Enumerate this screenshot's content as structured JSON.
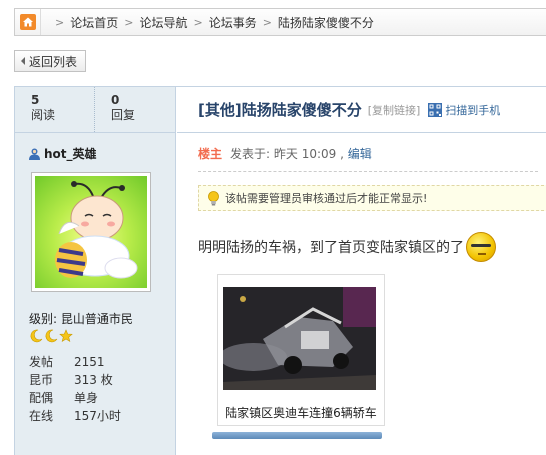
{
  "breadcrumb": {
    "items": [
      "论坛首页",
      "论坛导航",
      "论坛事务",
      "陆扬陆家傻傻不分"
    ]
  },
  "back_button": {
    "label": "返回列表"
  },
  "thread_stats": {
    "reads": {
      "value": "5",
      "label": "阅读"
    },
    "replies": {
      "value": "0",
      "label": "回复"
    }
  },
  "thread": {
    "title": "[其他]陆扬陆家傻傻不分",
    "copy_link": "[复制链接]",
    "qr_label": "扫描到手机"
  },
  "author": {
    "name": "hot_英雄",
    "level": "级别: 昆山普通市民",
    "info": [
      {
        "key": "发帖",
        "value": "2151"
      },
      {
        "key": "昆币",
        "value": "313 枚"
      },
      {
        "key": "配偶",
        "value": "单身"
      },
      {
        "key": "在线",
        "value": "157小时"
      }
    ]
  },
  "post": {
    "host_badge": "楼主",
    "posted_at": "发表于: 昨天 10:09",
    "separator": ",",
    "edit_label": "编辑",
    "notice": "该帖需要管理员审核通过后才能正常显示!",
    "body": "明明陆扬的车祸，到了首页变陆家镇区的了",
    "image_caption": "陆家镇区奥迪车连撞6辆轿车"
  },
  "colors": {
    "accent": "#28446a",
    "host": "#f26c4f",
    "link": "#336699",
    "sidebar_bg": "#e5edf2",
    "border": "#c4d3e2"
  }
}
